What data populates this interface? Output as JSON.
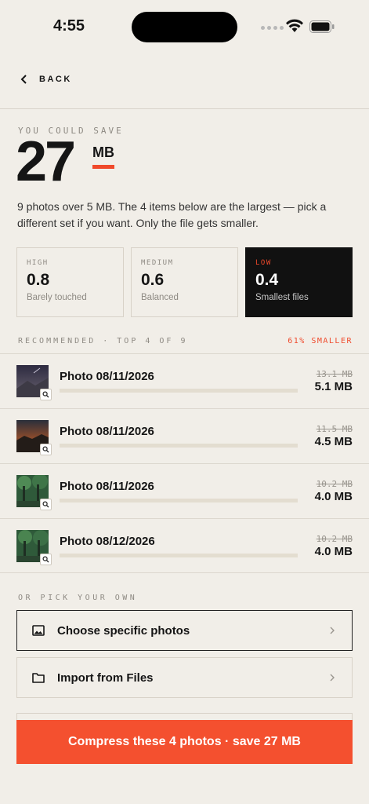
{
  "status_bar": {
    "time": "4:55"
  },
  "nav": {
    "back_label": "BACK"
  },
  "hero": {
    "eyebrow": "YOU COULD SAVE",
    "amount": "27",
    "unit": "MB",
    "description": "9 photos over 5 MB. The 4 items below are the largest — pick a different set if you want. Only the file gets smaller."
  },
  "quality_options": [
    {
      "label": "HIGH",
      "value": "0.8",
      "caption": "Barely touched",
      "selected": false
    },
    {
      "label": "MEDIUM",
      "value": "0.6",
      "caption": "Balanced",
      "selected": false
    },
    {
      "label": "LOW",
      "value": "0.4",
      "caption": "Smallest files",
      "selected": true
    }
  ],
  "recommended": {
    "heading": "RECOMMENDED · TOP 4 OF 9",
    "savings": "61% SMALLER",
    "photos": [
      {
        "name": "Photo 08/11/2026",
        "original_size": "13.1 MB",
        "new_size": "5.1 MB",
        "thumb": "mountain-night"
      },
      {
        "name": "Photo 08/11/2026",
        "original_size": "11.5 MB",
        "new_size": "4.5 MB",
        "thumb": "sunset-ridge"
      },
      {
        "name": "Photo 08/11/2026",
        "original_size": "10.2 MB",
        "new_size": "4.0 MB",
        "thumb": "forest"
      },
      {
        "name": "Photo 08/12/2026",
        "original_size": "10.2 MB",
        "new_size": "4.0 MB",
        "thumb": "forest"
      }
    ]
  },
  "pick_own": {
    "heading": "OR PICK YOUR OWN",
    "choose_label": "Choose specific photos",
    "import_label": "Import from Files"
  },
  "cta": {
    "label": "Compress these 4 photos · save 27 MB"
  },
  "colors": {
    "accent": "#f4502f",
    "background": "#f1eee8",
    "selected_card": "#111111"
  }
}
